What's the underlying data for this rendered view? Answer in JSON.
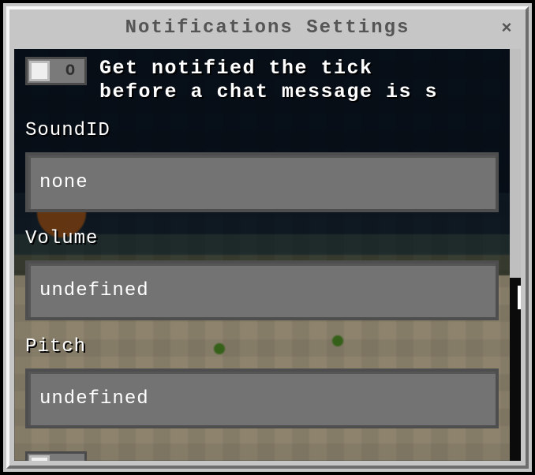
{
  "window": {
    "title": "Notifications Settings",
    "close_glyph": "×"
  },
  "toggles": {
    "pre_chat_tick": {
      "label": "Get notified the tick\nbefore a chat message is s",
      "state_glyph": "O",
      "enabled": false
    }
  },
  "fields": {
    "sound_id": {
      "label": "SoundID",
      "value": "none"
    },
    "volume": {
      "label": "Volume",
      "value": "undefined"
    },
    "pitch": {
      "label": "Pitch",
      "value": "undefined"
    }
  }
}
